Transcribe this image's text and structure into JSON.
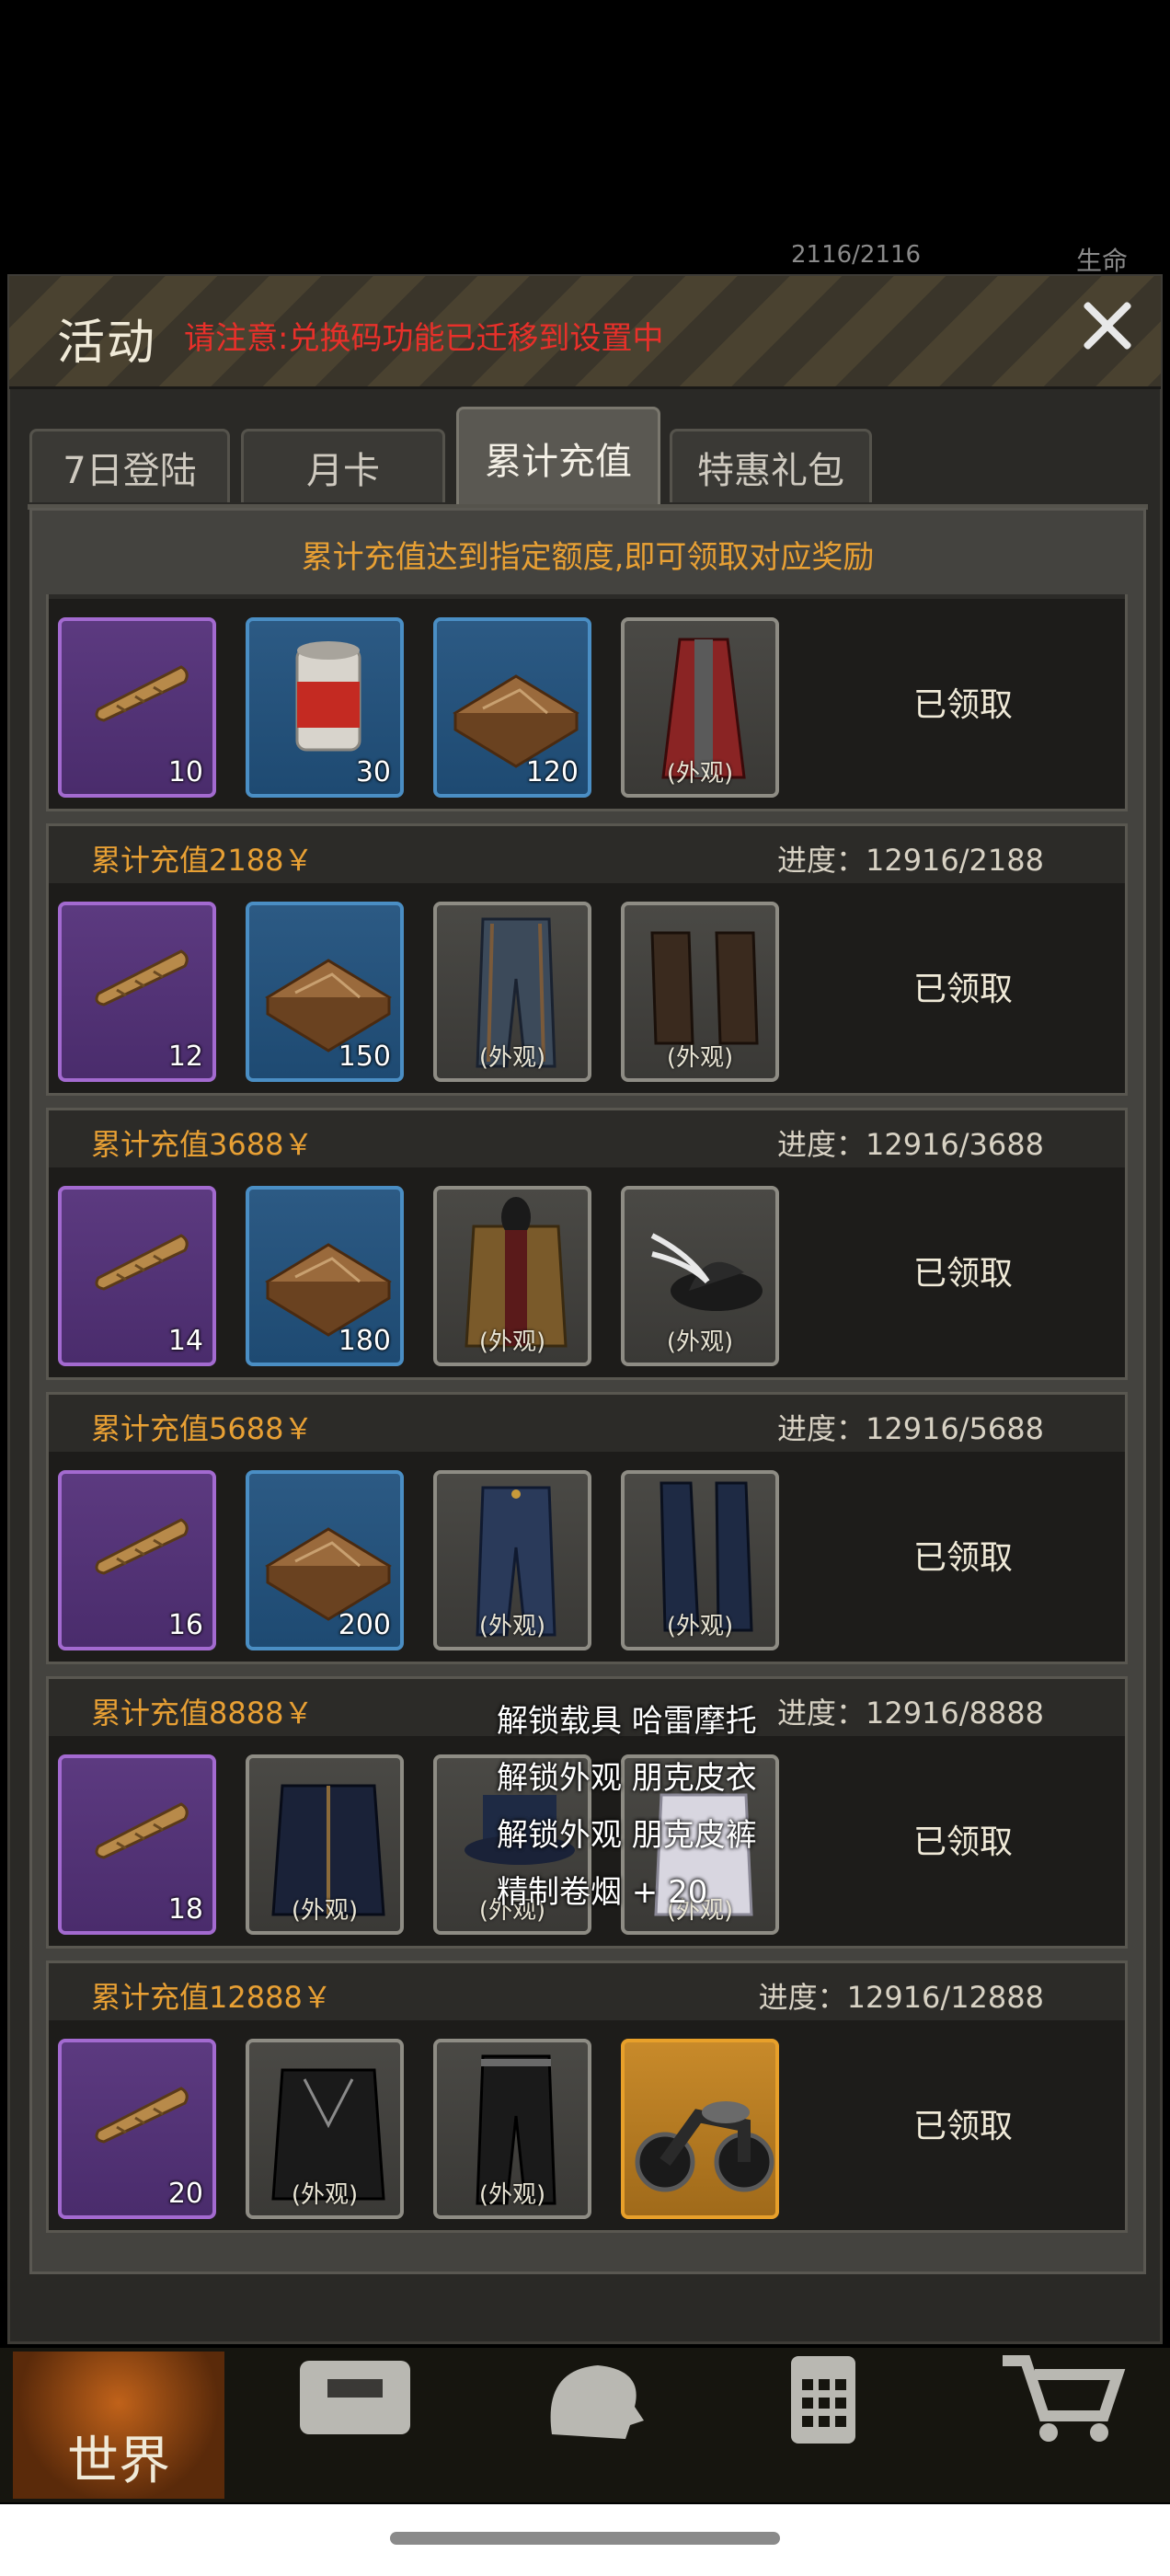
{
  "hud": {
    "hp": "2116/2116",
    "life_label": "生命"
  },
  "dialog": {
    "title": "活动",
    "notice": "请注意:兑换码功能已迁移到设置中"
  },
  "tabs": [
    {
      "label": "7日登陆"
    },
    {
      "label": "月卡"
    },
    {
      "label": "累计充值",
      "active": true
    },
    {
      "label": "特惠礼包"
    }
  ],
  "panel_title": "累计充值达到指定额度,即可领取对应奖励",
  "look_label": "(外观)",
  "tiers": [
    {
      "label": "",
      "progress": "",
      "claim": "已领取",
      "items": [
        {
          "icon": "cigar-icon",
          "rarity": "purple",
          "qty": "10"
        },
        {
          "icon": "meat-can-icon",
          "rarity": "blue",
          "qty": "30"
        },
        {
          "icon": "wood-crate-icon",
          "rarity": "blue",
          "qty": "120"
        },
        {
          "icon": "red-coat-icon",
          "rarity": "gray",
          "look": true
        }
      ]
    },
    {
      "label": "累计充值2188￥",
      "progress": "进度：12916/2188",
      "claim": "已领取",
      "items": [
        {
          "icon": "cigar-icon",
          "rarity": "purple",
          "qty": "12"
        },
        {
          "icon": "wood-crate-icon",
          "rarity": "blue",
          "qty": "150"
        },
        {
          "icon": "striped-pants-icon",
          "rarity": "gray",
          "look": true
        },
        {
          "icon": "boots-icon",
          "rarity": "gray",
          "look": true
        }
      ]
    },
    {
      "label": "累计充值3688￥",
      "progress": "进度：12916/3688",
      "claim": "已领取",
      "items": [
        {
          "icon": "cigar-icon",
          "rarity": "purple",
          "qty": "14"
        },
        {
          "icon": "wood-crate-icon",
          "rarity": "blue",
          "qty": "180"
        },
        {
          "icon": "brown-jacket-icon",
          "rarity": "gray",
          "look": true
        },
        {
          "icon": "feather-hat-icon",
          "rarity": "gray",
          "look": true
        }
      ]
    },
    {
      "label": "累计充值5688￥",
      "progress": "进度：12916/5688",
      "claim": "已领取",
      "items": [
        {
          "icon": "cigar-icon",
          "rarity": "purple",
          "qty": "16"
        },
        {
          "icon": "wood-crate-icon",
          "rarity": "blue",
          "qty": "200"
        },
        {
          "icon": "blue-pants-icon",
          "rarity": "gray",
          "look": true
        },
        {
          "icon": "tall-boots-icon",
          "rarity": "gray",
          "look": true
        }
      ]
    },
    {
      "label": "累计充值8888￥",
      "progress": "进度：12916/8888",
      "claim": "已领取",
      "items": [
        {
          "icon": "cigar-icon",
          "rarity": "purple",
          "qty": "18"
        },
        {
          "icon": "punk-jacket-icon",
          "rarity": "gray",
          "look": true
        },
        {
          "icon": "top-hat-icon",
          "rarity": "gray",
          "look": true
        },
        {
          "icon": "white-shirt-icon",
          "rarity": "gray",
          "look": true
        }
      ]
    },
    {
      "label": "累计充值12888￥",
      "progress": "进度：12916/12888",
      "claim": "已领取",
      "items": [
        {
          "icon": "cigar-icon",
          "rarity": "purple",
          "qty": "20"
        },
        {
          "icon": "leather-jacket-icon",
          "rarity": "gray",
          "look": true
        },
        {
          "icon": "leather-pants-icon",
          "rarity": "gray",
          "look": true
        },
        {
          "icon": "motorcycle-icon",
          "rarity": "gold"
        }
      ]
    }
  ],
  "tooltip": [
    "解锁载具 哈雷摩托",
    "解锁外观 朋克皮衣",
    "解锁外观 朋克皮裤",
    "精制卷烟 + 20"
  ],
  "nav": {
    "world_label": "世界"
  },
  "colors": {
    "accent_orange": "#e8a034",
    "notice_red": "#e8302a",
    "purple": "#a36ad0",
    "blue": "#4a8ec4",
    "gold": "#e8a02a"
  }
}
